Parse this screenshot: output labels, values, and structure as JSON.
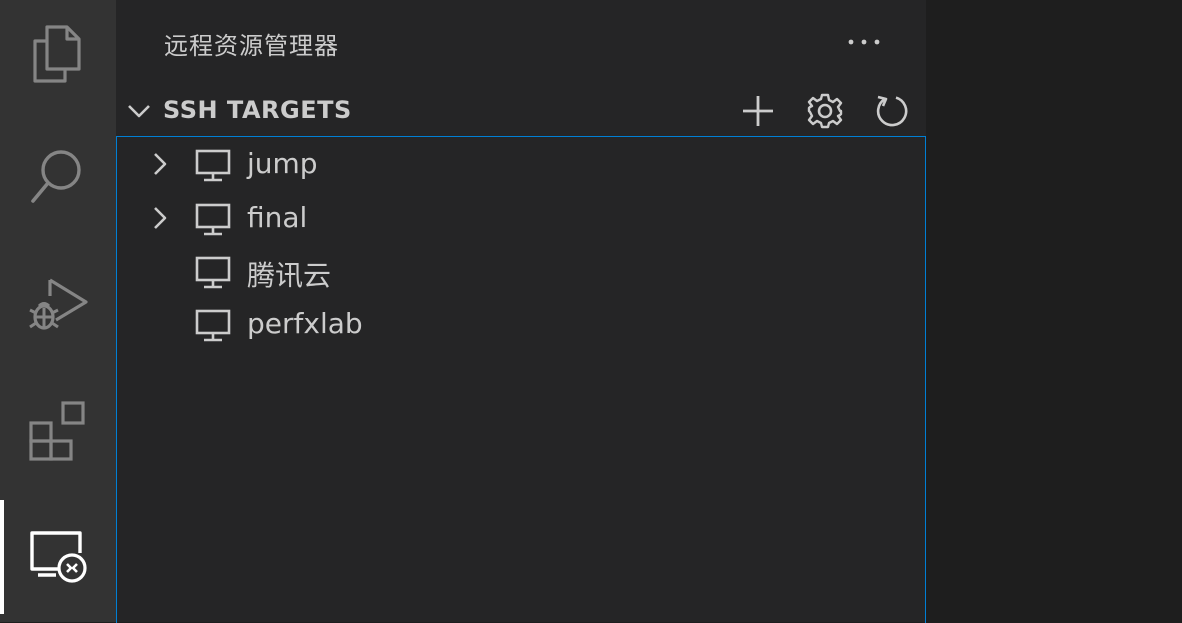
{
  "activity_bar": {
    "items": [
      {
        "name": "explorer",
        "icon": "files-icon"
      },
      {
        "name": "search",
        "icon": "search-icon"
      },
      {
        "name": "run-debug",
        "icon": "run-debug-icon"
      },
      {
        "name": "extensions",
        "icon": "extensions-icon"
      },
      {
        "name": "remote-explorer",
        "icon": "remote-explorer-icon",
        "active": true
      }
    ]
  },
  "sidebar": {
    "title": "远程资源管理器",
    "more_icon": "ellipsis-icon",
    "section": {
      "title": "SSH TARGETS",
      "expanded": true,
      "actions": [
        {
          "name": "add",
          "icon": "plus-icon"
        },
        {
          "name": "configure",
          "icon": "gear-icon"
        },
        {
          "name": "refresh",
          "icon": "refresh-icon"
        }
      ]
    },
    "targets": [
      {
        "label": "jump",
        "expandable": true
      },
      {
        "label": "final",
        "expandable": true
      },
      {
        "label": "腾讯云",
        "expandable": false
      },
      {
        "label": "perfxlab",
        "expandable": false
      }
    ]
  },
  "colors": {
    "activity_bar_bg": "#333333",
    "sidebar_bg": "#252526",
    "editor_bg": "#1e1e1e",
    "focus_border": "#007fd4",
    "text": "#cccccc",
    "icon_inactive": "#858585",
    "icon_active": "#ffffff"
  }
}
